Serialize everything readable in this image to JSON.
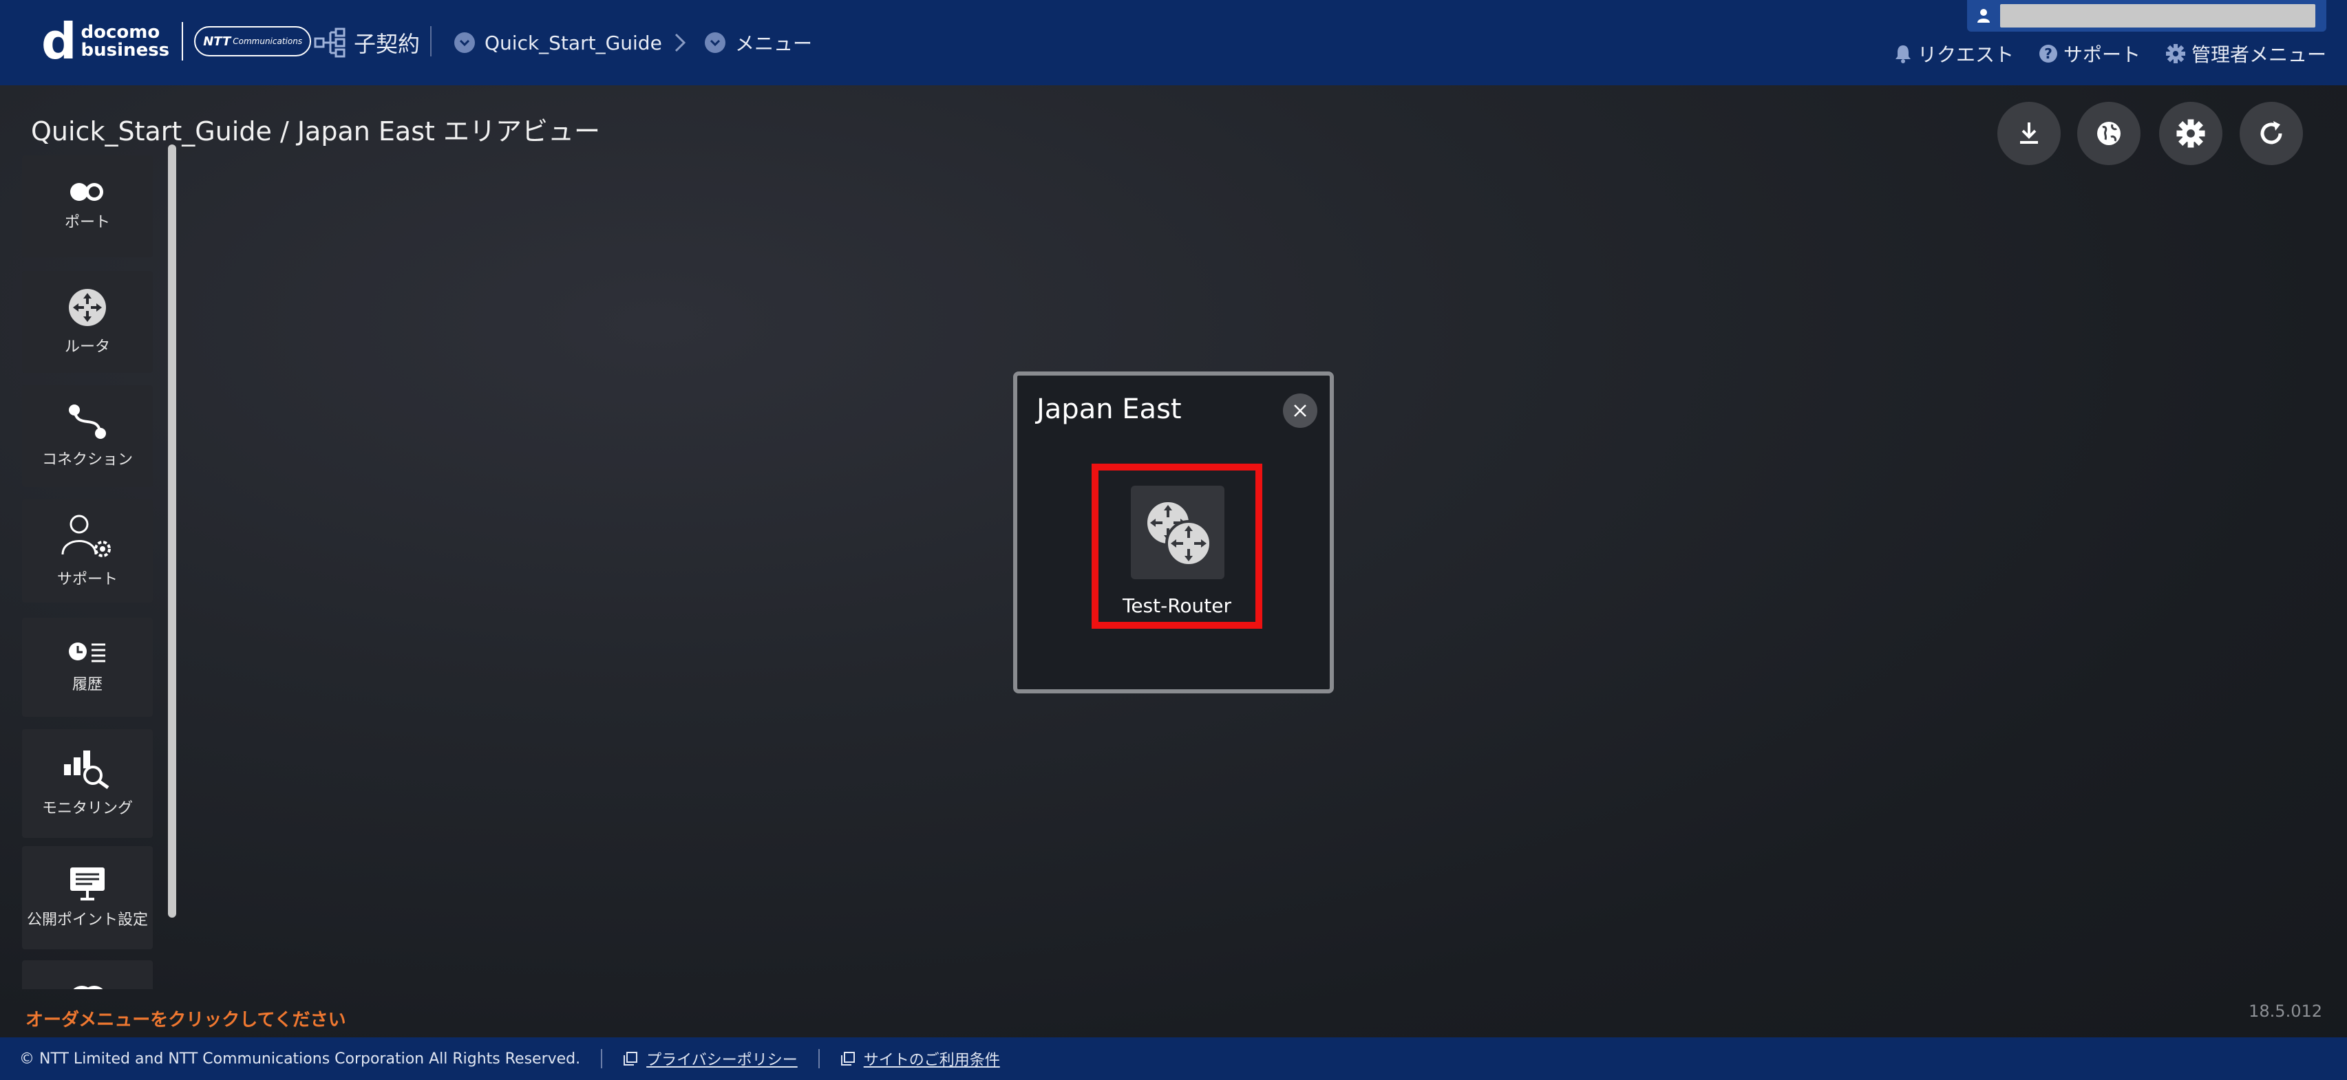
{
  "header": {
    "logo_d": "d",
    "logo_line1": "docomo",
    "logo_line2": "business",
    "ntt_badge": "NTT",
    "ntt_badge_small": "Communications",
    "contract_label": "子契約",
    "breadcrumb_guide": "Quick_Start_Guide",
    "breadcrumb_menu": "メニュー",
    "links": {
      "request": "リクエスト",
      "support": "サポート",
      "admin_menu": "管理者メニュー"
    }
  },
  "page_title": "Quick_Start_Guide / Japan East エリアビュー",
  "toolbar": {
    "icons": [
      "download-icon",
      "globe-icon",
      "gear-icon",
      "refresh-icon"
    ]
  },
  "sidebar": {
    "items": [
      {
        "label": "ポート",
        "icon": "port-icon"
      },
      {
        "label": "ルータ",
        "icon": "router-icon"
      },
      {
        "label": "コネクション",
        "icon": "connection-icon"
      },
      {
        "label": "サポート",
        "icon": "support-user-icon"
      },
      {
        "label": "履歴",
        "icon": "history-icon"
      },
      {
        "label": "モニタリング",
        "icon": "monitoring-icon"
      },
      {
        "label": "公開ポイント設定",
        "icon": "public-point-icon"
      }
    ]
  },
  "area_panel": {
    "title": "Japan East",
    "router_name": "Test-Router"
  },
  "bottom_hint": "オーダメニューをクリックしてください",
  "version": "18.5.012",
  "footer": {
    "copyright": "© NTT Limited and NTT Communications Corporation All Rights Reserved.",
    "privacy": "プライバシーポリシー",
    "terms": "サイトのご利用条件"
  },
  "colors": {
    "header_bg": "#0b2a66",
    "highlight": "#ee1111",
    "hint": "#f07830"
  }
}
